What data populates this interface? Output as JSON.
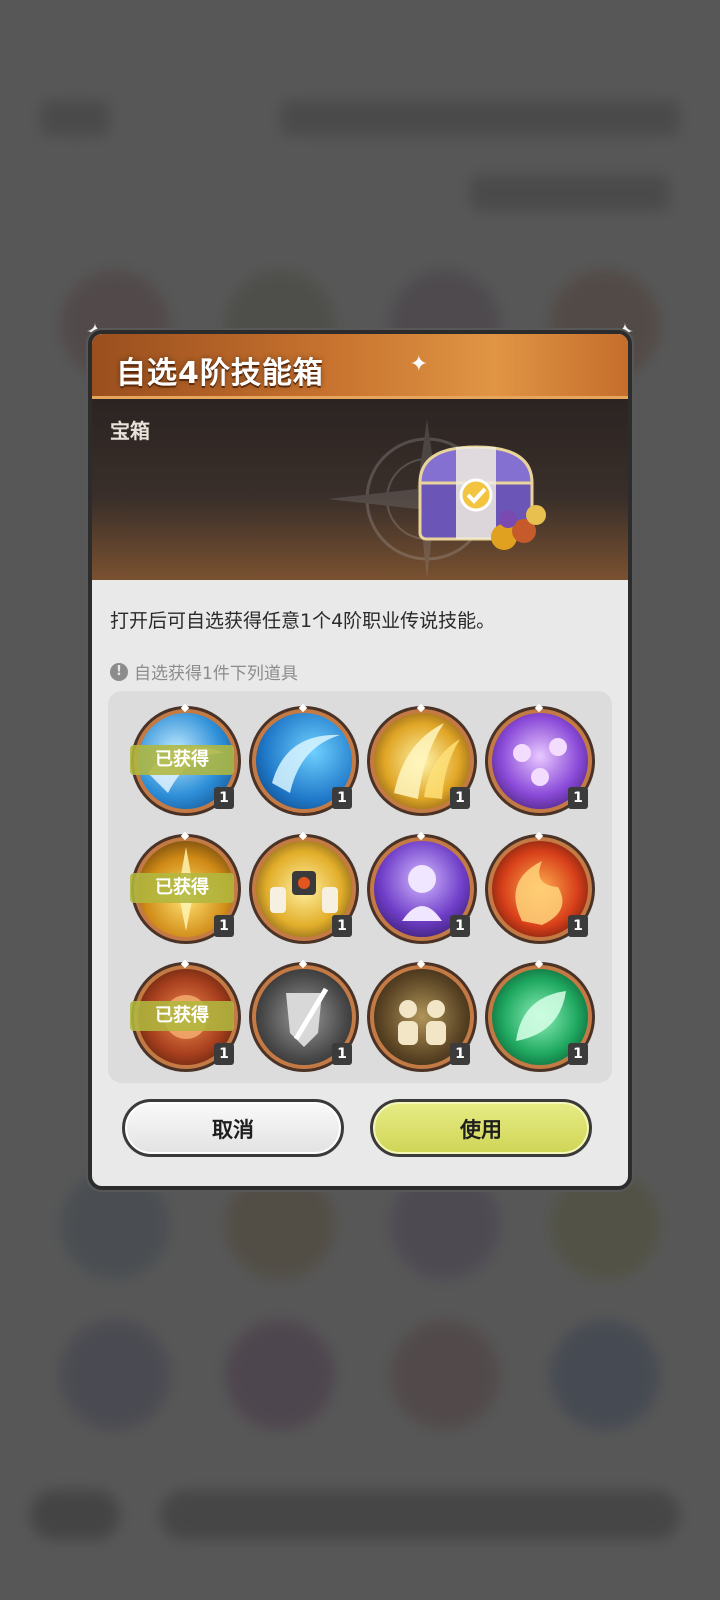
{
  "dialog": {
    "title": "自选4阶技能箱",
    "category": "宝箱",
    "description": "打开后可自选获得任意1个4阶职业传说技能。",
    "hint_text": "自选获得1件下列道具",
    "hint_icon": "!",
    "cancel_label": "取消",
    "use_label": "使用",
    "title_sparkle": "✦",
    "corner_glyph": "✦"
  },
  "items": [
    {
      "icon": "water-wave-skill-icon",
      "quantity": "1",
      "owned_label": "已获得"
    },
    {
      "icon": "water-crescent-skill-icon",
      "quantity": "1"
    },
    {
      "icon": "golden-slash-skill-icon",
      "quantity": "1"
    },
    {
      "icon": "purple-roses-skill-icon",
      "quantity": "1"
    },
    {
      "icon": "golden-burst-skill-icon",
      "quantity": "1",
      "owned_label": "已获得"
    },
    {
      "icon": "golden-summon-skill-icon",
      "quantity": "1"
    },
    {
      "icon": "purple-spirit-skill-icon",
      "quantity": "1"
    },
    {
      "icon": "flame-swirl-skill-icon",
      "quantity": "1"
    },
    {
      "icon": "fire-orb-skill-icon",
      "quantity": "1",
      "owned_label": "已获得"
    },
    {
      "icon": "shield-strike-skill-icon",
      "quantity": "1"
    },
    {
      "icon": "team-support-skill-icon",
      "quantity": "1"
    },
    {
      "icon": "green-leaf-skill-icon",
      "quantity": "1"
    }
  ],
  "colors": {
    "header_accent": "#c8732f",
    "owned_badge": "#b1b73f",
    "use_button": "#d9de6a",
    "item_ring": "#c47a45"
  }
}
